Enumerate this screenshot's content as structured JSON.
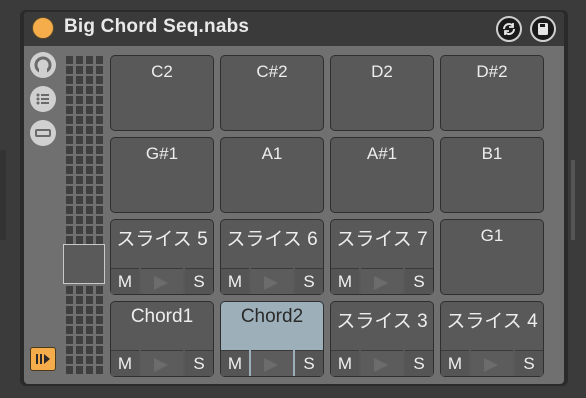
{
  "device": {
    "title": "Big Chord Seq.nabs",
    "accent_color": "#f5ad4b",
    "active_pad_color": "#9db0ba"
  },
  "header_buttons": [
    {
      "icon": "refresh-icon"
    },
    {
      "icon": "save-icon"
    }
  ],
  "side_buttons": [
    {
      "icon": "dial-icon"
    },
    {
      "icon": "list-icon"
    },
    {
      "icon": "minimize-icon"
    }
  ],
  "pads": [
    {
      "label": "C2",
      "has_controls": false,
      "active": false
    },
    {
      "label": "C#2",
      "has_controls": false,
      "active": false
    },
    {
      "label": "D2",
      "has_controls": false,
      "active": false
    },
    {
      "label": "D#2",
      "has_controls": false,
      "active": false
    },
    {
      "label": "G#1",
      "has_controls": false,
      "active": false
    },
    {
      "label": "A1",
      "has_controls": false,
      "active": false
    },
    {
      "label": "A#1",
      "has_controls": false,
      "active": false
    },
    {
      "label": "B1",
      "has_controls": false,
      "active": false
    },
    {
      "label": "スライス 5",
      "has_controls": true,
      "active": false
    },
    {
      "label": "スライス 6",
      "has_controls": true,
      "active": false
    },
    {
      "label": "スライス 7",
      "has_controls": true,
      "active": false
    },
    {
      "label": "G1",
      "has_controls": false,
      "active": false
    },
    {
      "label": "Chord1",
      "has_controls": true,
      "active": false
    },
    {
      "label": "Chord2",
      "has_controls": true,
      "active": true
    },
    {
      "label": "スライス 3",
      "has_controls": true,
      "active": false
    },
    {
      "label": "スライス 4",
      "has_controls": true,
      "active": false
    }
  ],
  "pad_controls": {
    "mute_label": "M",
    "solo_label": "S"
  }
}
